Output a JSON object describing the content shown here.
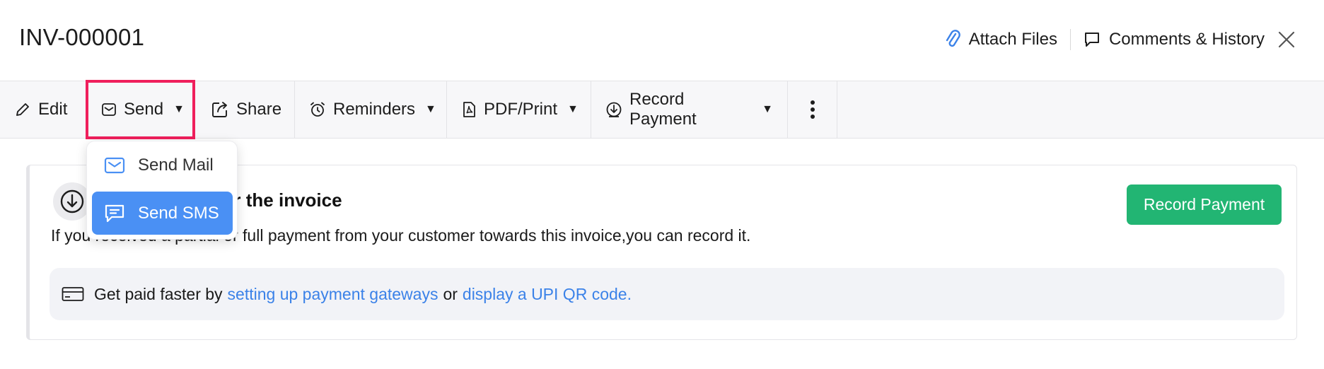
{
  "header": {
    "title": "INV-000001",
    "attach_label": "Attach Files",
    "comments_label": "Comments & History"
  },
  "toolbar": {
    "edit": "Edit",
    "send": "Send",
    "share": "Share",
    "reminders": "Reminders",
    "pdf_print": "PDF/Print",
    "record_payment": "Record Payment"
  },
  "dropdown": {
    "items": [
      "Send Mail",
      "Send SMS"
    ],
    "selected": "Send SMS"
  },
  "card": {
    "heading": "t for the invoice",
    "desc": "If you received a partial or full payment from your customer towards this invoice,you can record it.",
    "record_button": "Record Payment",
    "gateway_prefix": "Get paid faster by",
    "gateway_link1": "setting up payment gateways",
    "gateway_mid": "or",
    "gateway_link2": "display a UPI QR code."
  },
  "colors": {
    "accent_blue": "#4a90f4",
    "link_blue": "#3b82e8",
    "record_green": "#22b573",
    "highlight_red": "#ef1f5c"
  },
  "icons": [
    "paperclip-icon",
    "comment-icon",
    "close-icon",
    "pencil-icon",
    "envelope-icon",
    "share-icon",
    "alarm-clock-icon",
    "pdf-icon",
    "download-circle-icon",
    "more-vertical-icon",
    "mail-icon",
    "sms-icon",
    "credit-card-icon"
  ]
}
